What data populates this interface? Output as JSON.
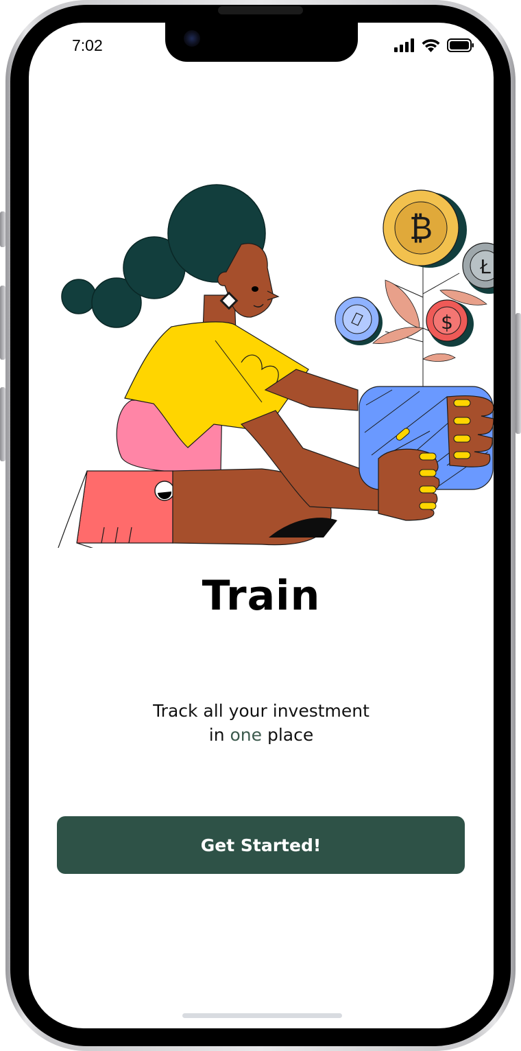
{
  "status_bar": {
    "time": "7:02",
    "icons": [
      "cellular-signal-icon",
      "wifi-icon",
      "battery-icon"
    ]
  },
  "onboarding": {
    "title": "Train",
    "subtitle_line1": "Track all your investment",
    "subtitle_line2_prefix": "in ",
    "subtitle_line2_accent": "one",
    "subtitle_line2_suffix": " place",
    "cta_label": "Get Started!"
  },
  "colors": {
    "brand": "#2e5247",
    "accent_text": "#3c5a4d"
  }
}
